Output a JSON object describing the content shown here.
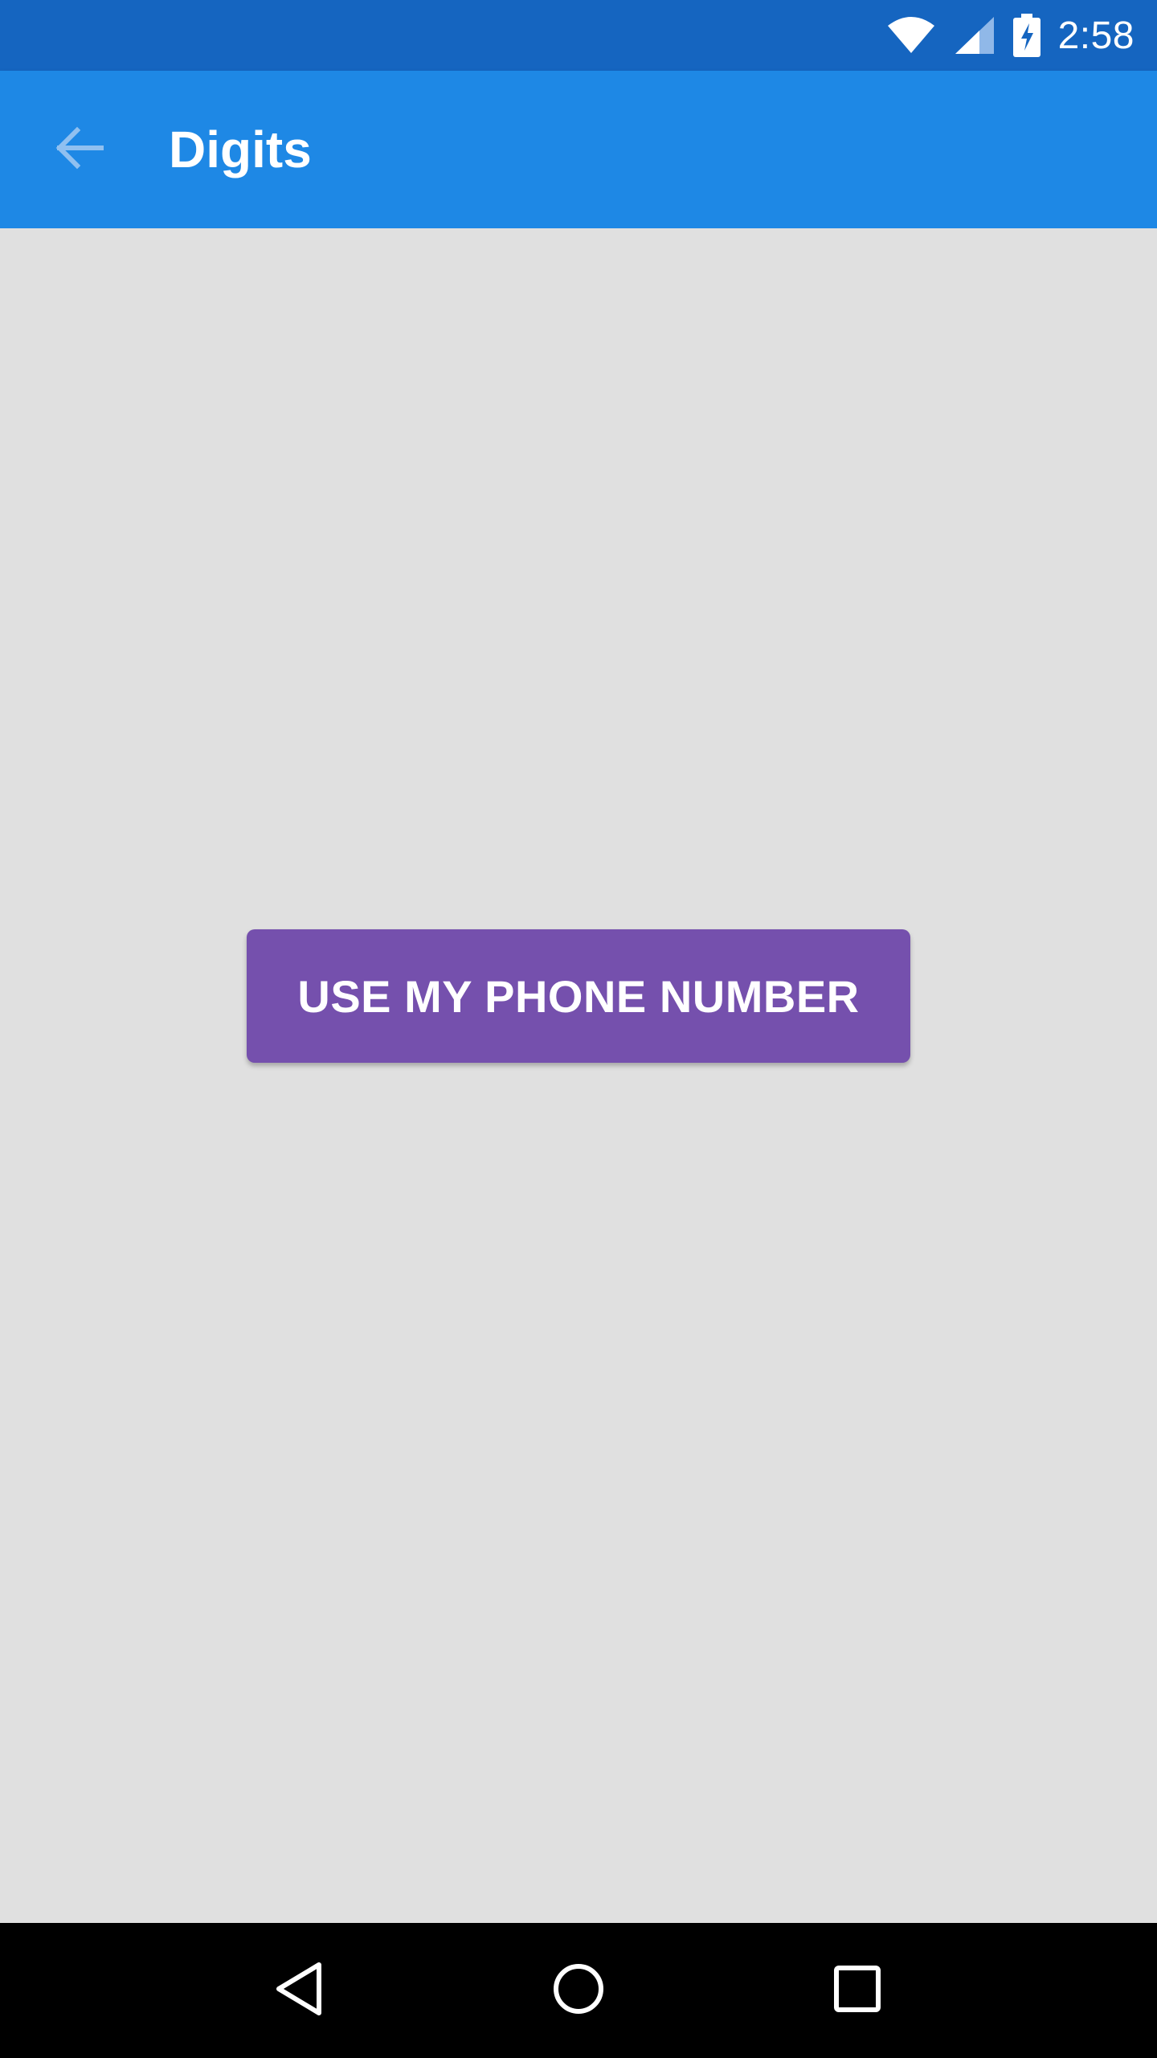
{
  "status_bar": {
    "time": "2:58",
    "icons": [
      "wifi-icon",
      "cell-signal-icon",
      "battery-charging-icon"
    ],
    "background": "#1565c0"
  },
  "app_bar": {
    "title": "Digits",
    "back_icon": "arrow-back-icon",
    "background": "#1e88e5"
  },
  "main": {
    "button_label": "USE MY PHONE NUMBER",
    "button_color": "#7550ad",
    "background": "#e0e0e0"
  },
  "nav_bar": {
    "buttons": [
      "back-triangle-icon",
      "home-circle-icon",
      "recents-square-icon"
    ]
  }
}
